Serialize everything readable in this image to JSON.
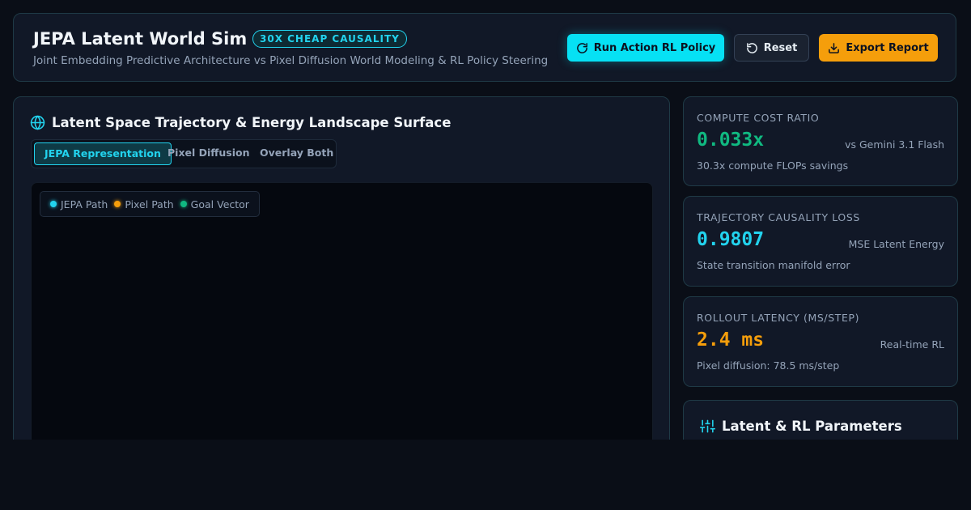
{
  "header": {
    "title": "JEPA Latent World Sim",
    "badge": "30X CHEAP CAUSALITY",
    "subtitle": "Joint Embedding Predictive Architecture vs Pixel Diffusion World Modeling & RL Policy Steering",
    "buttons": {
      "run": "Run Action RL Policy",
      "reset": "Reset",
      "export": "Export Report"
    }
  },
  "main": {
    "title": "Latent Space Trajectory & Energy Landscape Surface",
    "tabs": [
      {
        "label": "JEPA Representation",
        "active": true
      },
      {
        "label": "Pixel Diffusion",
        "active": false
      },
      {
        "label": "Overlay Both",
        "active": false
      }
    ],
    "legend": [
      {
        "label": "JEPA Path",
        "color": "#22d3ee"
      },
      {
        "label": "Pixel Path",
        "color": "#f59e0b"
      },
      {
        "label": "Goal Vector",
        "color": "#10b981"
      }
    ]
  },
  "stats": [
    {
      "label": "Compute Cost Ratio",
      "value": "0.033x",
      "aside": "vs Gemini 3.1 Flash",
      "note": "30.3x compute FLOPs savings",
      "color": "#10b981"
    },
    {
      "label": "Trajectory Causality Loss",
      "value": "0.9807",
      "aside": "MSE Latent Energy",
      "note": "State transition manifold error",
      "color": "#22d3ee"
    },
    {
      "label": "Rollout Latency (ms/step)",
      "value": "2.4 ms",
      "aside": "Real-time RL",
      "note": "Pixel diffusion: 78.5 ms/step",
      "color": "#f59e0b"
    }
  ],
  "params": {
    "title": "Latent & RL Parameters"
  },
  "colors": {
    "accent": "#22d3ee",
    "warning": "#f59e0b",
    "success": "#10b981",
    "background": "#0a0e17",
    "panel": "#111827"
  }
}
